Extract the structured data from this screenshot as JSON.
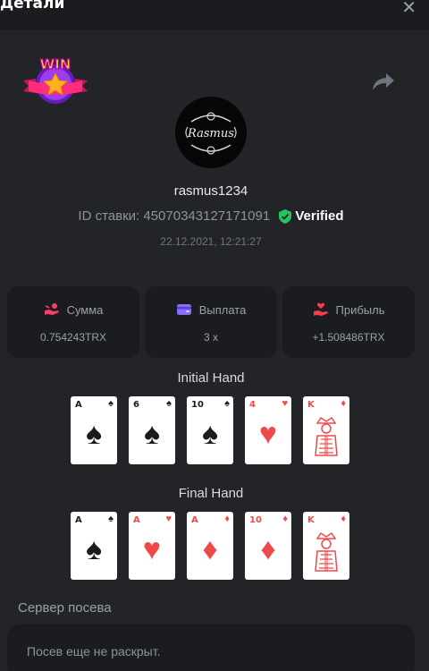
{
  "header": {
    "title": "Детали",
    "close_glyph": "✕"
  },
  "player": {
    "username": "rasmus1234",
    "bet_label": "ID ставки:",
    "bet_id": "450703431271710​91",
    "verified": "Verified",
    "timestamp": "22.12.2021, 12:21:27",
    "avatar_text": "Rasmus"
  },
  "badge": {
    "text": "WIN"
  },
  "stats": [
    {
      "label": "Сумма",
      "value": "0.754243TRX",
      "icon": "hand-coins-icon",
      "color": "#ff3b6b"
    },
    {
      "label": "Выплата",
      "value": "3 x",
      "icon": "wallet-icon",
      "color": "#8b6cff"
    },
    {
      "label": "Прибыль",
      "value": "+1.508486TRX",
      "icon": "hand-heart-icon",
      "color": "#ff3b4e"
    }
  ],
  "initial_hand": {
    "title": "Initial Hand",
    "cards": [
      {
        "rank": "A",
        "suit": "♠",
        "color": "black"
      },
      {
        "rank": "6",
        "suit": "♠",
        "color": "black"
      },
      {
        "rank": "10",
        "suit": "♠",
        "color": "black"
      },
      {
        "rank": "4",
        "suit": "♥",
        "color": "red"
      },
      {
        "rank": "K",
        "suit": "♦",
        "color": "red"
      }
    ]
  },
  "final_hand": {
    "title": "Final Hand",
    "cards": [
      {
        "rank": "A",
        "suit": "♠",
        "color": "black"
      },
      {
        "rank": "A",
        "suit": "♥",
        "color": "red"
      },
      {
        "rank": "A",
        "suit": "♦",
        "color": "red"
      },
      {
        "rank": "10",
        "suit": "♦",
        "color": "red"
      },
      {
        "rank": "K",
        "suit": "♦",
        "color": "red"
      }
    ]
  },
  "server_seed": {
    "label": "Сервер посева",
    "value": "Посев еще не раскрыт."
  },
  "colors": {
    "background": "#232428",
    "panel": "#1b1c1f",
    "verified": "#22c55e"
  }
}
